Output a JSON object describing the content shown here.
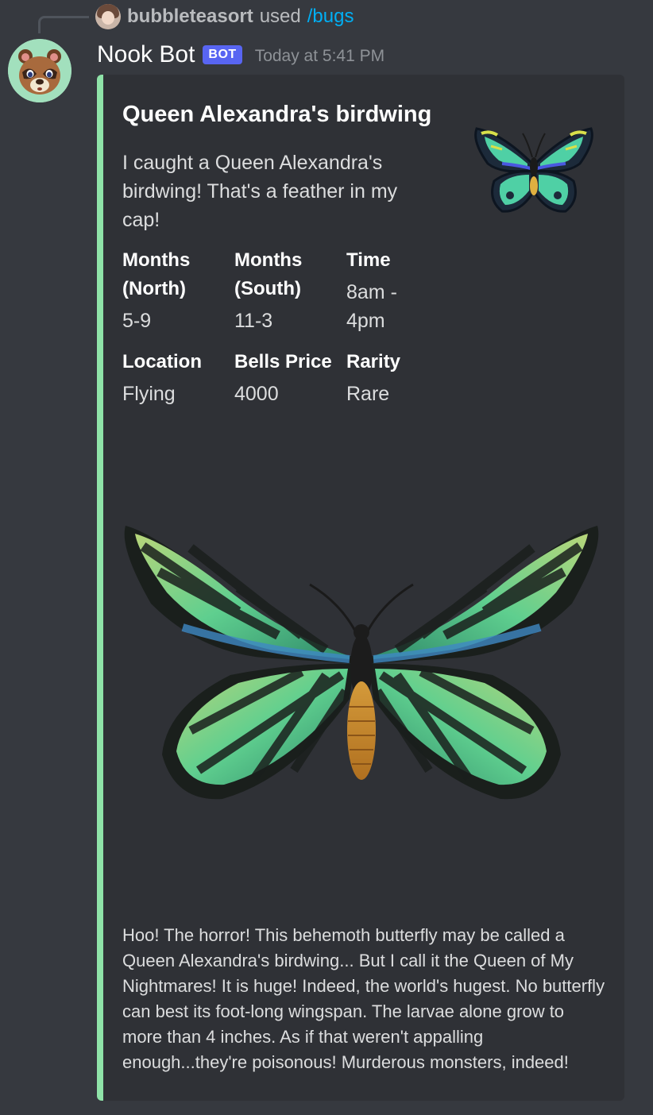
{
  "reply": {
    "user": "bubbleteasort",
    "used": "used",
    "command": "/bugs"
  },
  "message": {
    "author": "Nook Bot",
    "badge": "BOT",
    "timestamp": "Today at 5:41 PM"
  },
  "embed": {
    "accent_color": "#8fe3a8",
    "title": "Queen Alexandra's birdwing",
    "description": "I caught a Queen Alexandra's birdwing! That's a feather in my cap!",
    "fields": [
      {
        "name": "Months (North)",
        "value": "5-9"
      },
      {
        "name": "Months (South)",
        "value": "11-3"
      },
      {
        "name": "Time",
        "value": "8am - 4pm"
      },
      {
        "name": "Location",
        "value": "Flying"
      },
      {
        "name": "Bells Price",
        "value": "4000"
      },
      {
        "name": "Rarity",
        "value": "Rare"
      }
    ],
    "footer": "Hoo! The horror! This behemoth butterfly may be called a Queen Alexandra's birdwing... But I call it the Queen of My Nightmares! It is huge! Indeed, the world's hugest. No butterfly can best its foot-long wingspan. The larvae alone grow to more than 4 inches. As if that weren't appalling enough...they're poisonous! Murderous monsters, indeed!"
  }
}
